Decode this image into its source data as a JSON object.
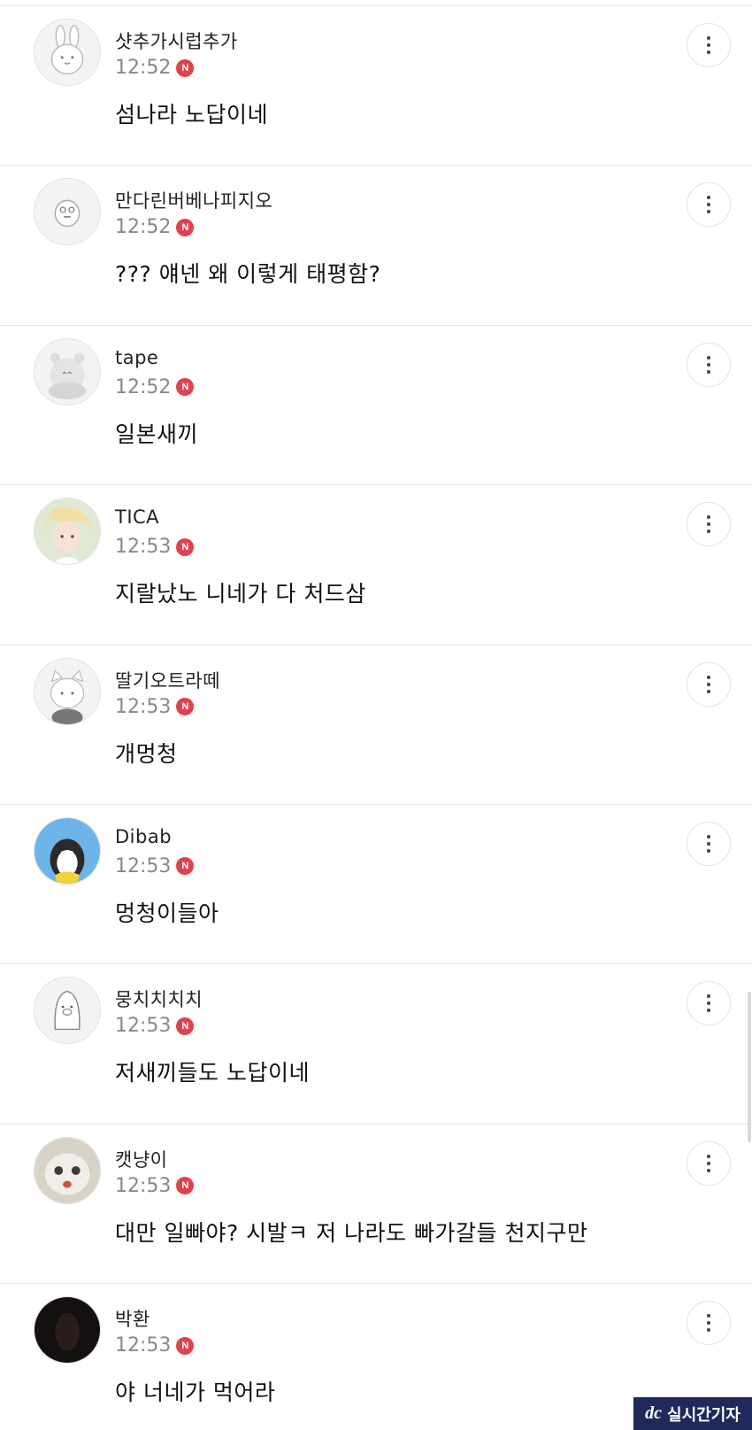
{
  "comments": [
    {
      "nick": "샷추가시럽추가",
      "time": "12:52",
      "badge": "N",
      "text": "섬나라 노답이네",
      "avatar_icon": "rabbit-avatar-icon"
    },
    {
      "nick": "만다린버베나피지오",
      "time": "12:52",
      "badge": "N",
      "text": "??? 얘넨 왜 이렇게 태평함?",
      "avatar_icon": "chick-avatar-icon"
    },
    {
      "nick": "tape",
      "time": "12:52",
      "badge": "N",
      "text": "일본새끼"
    },
    {
      "nick": "TICA",
      "time": "12:53",
      "badge": "N",
      "text": "지랄났노 니네가 다 처드삼"
    },
    {
      "nick": "딸기오트라떼",
      "time": "12:53",
      "badge": "N",
      "text": "개멍청"
    },
    {
      "nick": "Dibab",
      "time": "12:53",
      "badge": "N",
      "text": "멍청이들아"
    },
    {
      "nick": "뭉치치치치",
      "time": "12:53",
      "badge": "N",
      "text": "저새끼들도 노답이네"
    },
    {
      "nick": "캣냥이",
      "time": "12:53",
      "badge": "N",
      "text": "대만 일빠야? 시발ㅋ 저 나라도 빠가갈들 천지구만"
    },
    {
      "nick": "박환",
      "time": "12:53",
      "badge": "N",
      "text": "야 너네가 먹어라"
    }
  ],
  "watermark": {
    "logo": "dc",
    "label": "실시간기자"
  },
  "colors": {
    "badge": "#e0424d",
    "divider": "#e6e6e6",
    "time": "#888888",
    "watermark_bg": "#1f2a5a"
  }
}
